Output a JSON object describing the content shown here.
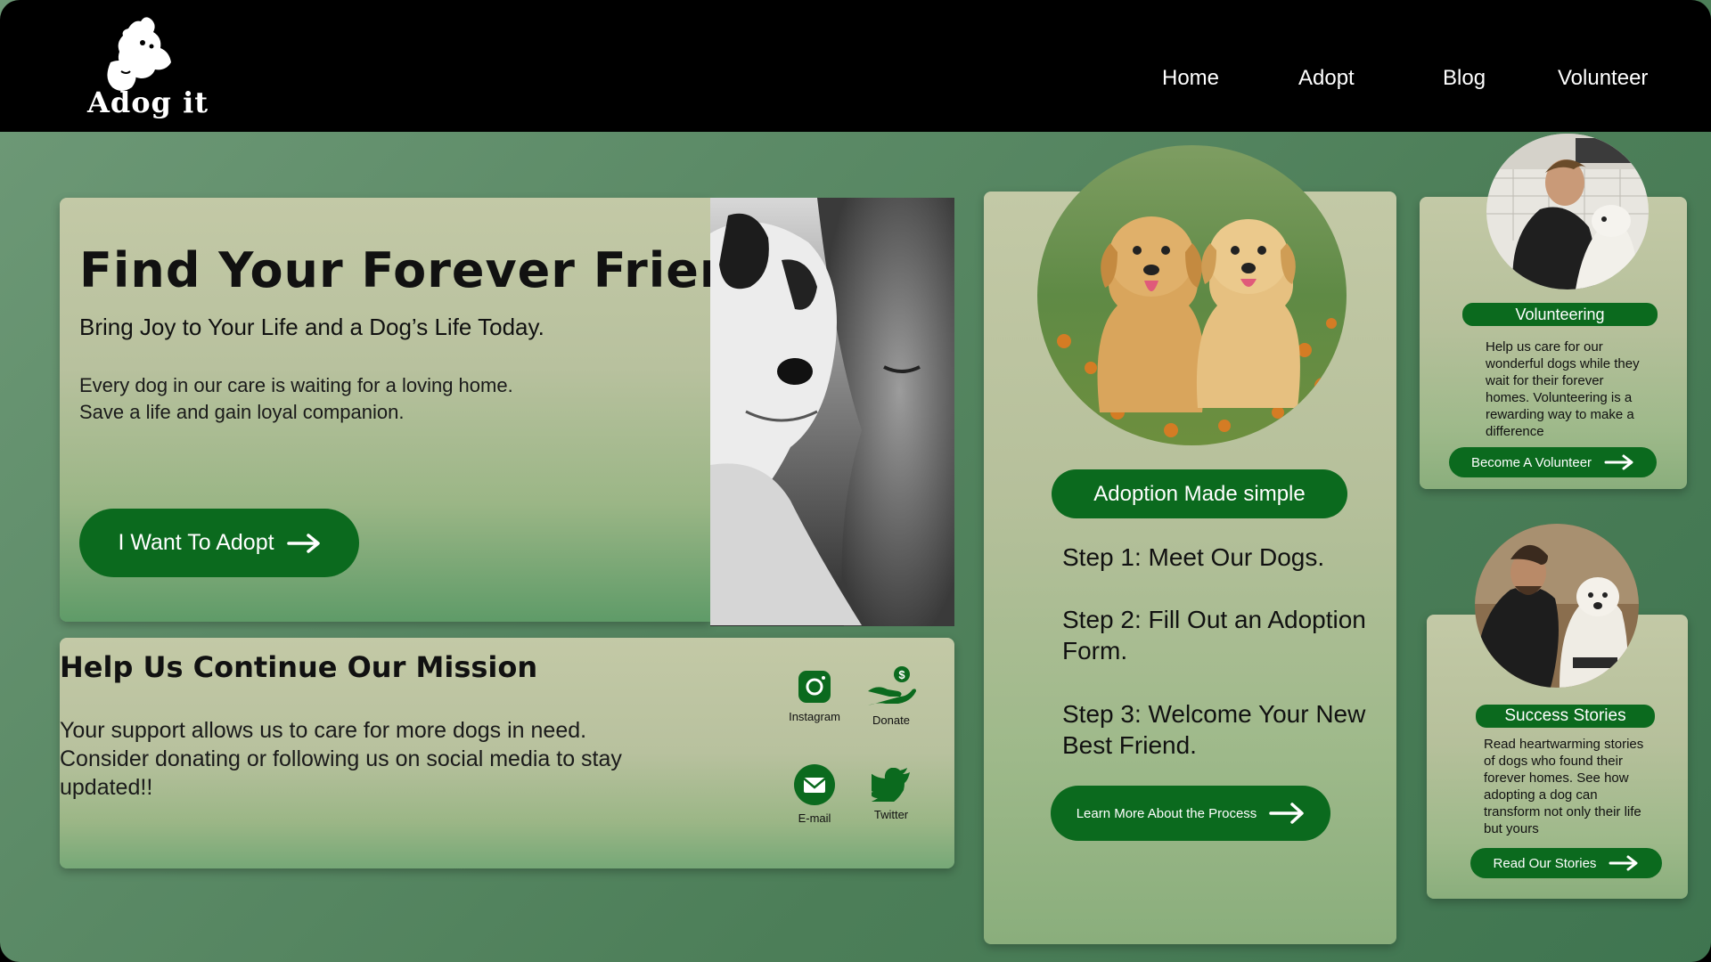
{
  "brand": {
    "name": "Adog it"
  },
  "nav": {
    "items": [
      "Home",
      "Adopt",
      "Blog",
      "Volunteer"
    ]
  },
  "hero": {
    "title": "Find Your Forever Friend",
    "subtitle": "Bring Joy to Your Life and a Dog’s Life Today.",
    "body_line1": "Every dog in our care is waiting for a loving home.",
    "body_line2": "Save a life and gain loyal companion.",
    "cta_label": "I Want To Adopt"
  },
  "mission": {
    "title": "Help Us Continue Our Mission",
    "body": "Your support allows us to care for more dogs in need. Consider donating or following us on social media to stay updated!!",
    "social": [
      {
        "label": "Instagram",
        "icon": "instagram-icon"
      },
      {
        "label": "Donate",
        "icon": "donate-icon"
      },
      {
        "label": "E-mail",
        "icon": "email-icon"
      },
      {
        "label": "Twitter",
        "icon": "twitter-icon"
      }
    ]
  },
  "process": {
    "badge": "Adoption Made simple",
    "steps": [
      "Step 1: Meet Our Dogs.",
      "Step 2: Fill Out an Adoption Form.",
      "Step 3: Welcome Your New Best Friend."
    ],
    "cta_label": "Learn More About the Process"
  },
  "volunteering": {
    "badge": "Volunteering",
    "body": "Help us care for our wonderful dogs while they wait for their forever homes. Volunteering is a rewarding way to make a difference",
    "cta_label": "Become A Volunteer"
  },
  "stories": {
    "badge": "Success Stories",
    "body": "Read heartwarming stories of dogs who found their forever homes. See how adopting a dog can transform not only their life but yours",
    "cta_label": "Read Our Stories"
  },
  "colors": {
    "accent": "#0b6a1e",
    "header_bg": "#000000",
    "card_bg": "#c2c8a4",
    "page_bg": "#5b8a66"
  }
}
